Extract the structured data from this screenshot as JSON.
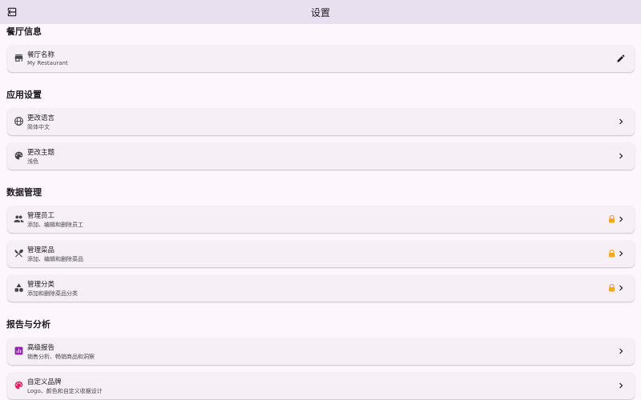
{
  "appbar": {
    "title": "设置",
    "back_icon": "exit-to-app-icon"
  },
  "sections": [
    {
      "title": "餐厅信息",
      "items": [
        {
          "title": "餐厅名称",
          "subtitle": "My Restaurant",
          "icon": "store-icon",
          "trailing": "edit-icon"
        }
      ]
    },
    {
      "title": "应用设置",
      "items": [
        {
          "title": "更改语言",
          "subtitle": "简体中文",
          "icon": "globe-icon",
          "trailing": "chevron-right-icon"
        },
        {
          "title": "更改主题",
          "subtitle": "浅色",
          "icon": "palette-icon",
          "trailing": "chevron-right-icon"
        }
      ]
    },
    {
      "title": "数据管理",
      "items": [
        {
          "title": "管理员工",
          "subtitle": "添加、编辑和删除员工",
          "icon": "people-icon",
          "trailing": "chevron-right-icon",
          "locked": true
        },
        {
          "title": "管理菜品",
          "subtitle": "添加、编辑和删除菜品",
          "icon": "utensils-icon",
          "trailing": "chevron-right-icon",
          "locked": true
        },
        {
          "title": "管理分类",
          "subtitle": "添加和删除菜品分类",
          "icon": "category-icon",
          "trailing": "chevron-right-icon",
          "locked": true
        }
      ]
    },
    {
      "title": "报告与分析",
      "items": [
        {
          "title": "高级报告",
          "subtitle": "销售分析、畅销商品和洞察",
          "icon": "analytics-icon",
          "trailing": "chevron-right-icon"
        },
        {
          "title": "自定义品牌",
          "subtitle": "Logo、颜色和自定义收据设计",
          "icon": "palette-color-icon",
          "trailing": "chevron-right-icon"
        }
      ]
    }
  ],
  "colors": {
    "appbar_bg": "#e8e0ee",
    "page_bg": "#fdf7fd",
    "card_bg": "#f6eff6",
    "lock": "#f4a81e",
    "analytics": "#8e24aa",
    "brand_palette": "#e91e63"
  }
}
